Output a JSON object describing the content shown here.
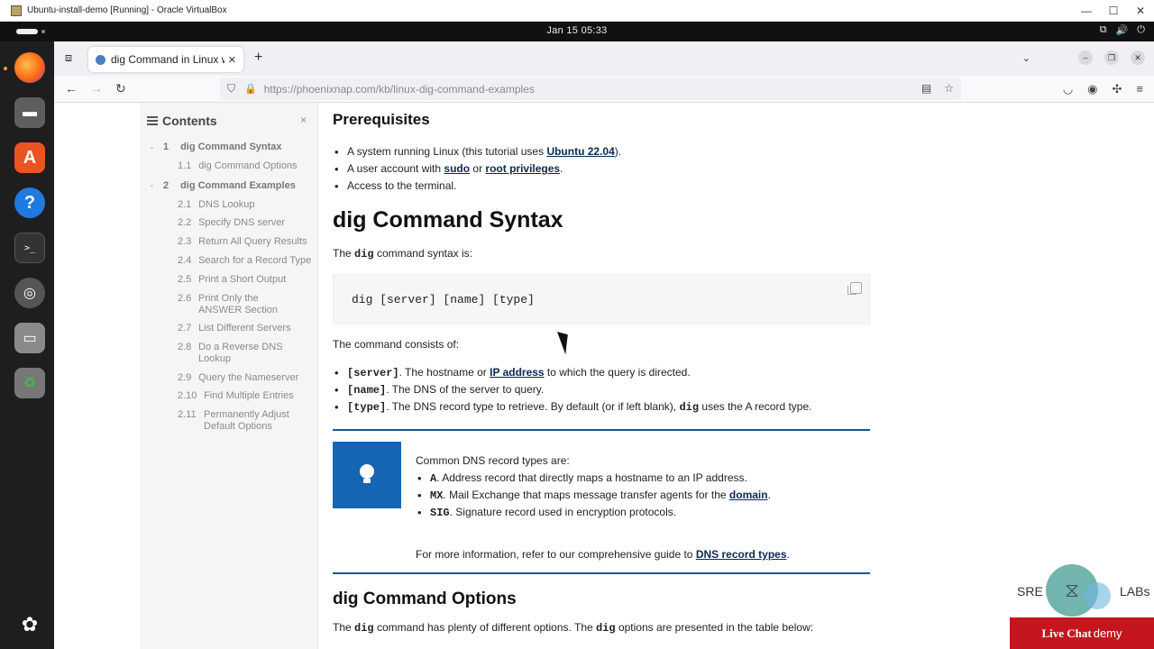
{
  "host_window": {
    "title": "Ubuntu-install-demo [Running] - Oracle VirtualBox",
    "min": "—",
    "max": "☐",
    "close": "✕"
  },
  "gnome": {
    "clock": "Jan 15  05:33"
  },
  "browser": {
    "tab_title": "dig Command in Linux wi",
    "tab_close": "✕",
    "new_tab": "+",
    "url_host": "https://phoenixnap.com",
    "url_path": "/kb/linux-dig-command-examples"
  },
  "toc": {
    "title": "Contents",
    "close": "×",
    "items": [
      {
        "num": "1",
        "label": "dig Command Syntax"
      },
      {
        "num": "1.1",
        "label": "dig Command Options"
      },
      {
        "num": "2",
        "label": "dig Command Examples"
      },
      {
        "num": "2.1",
        "label": "DNS Lookup"
      },
      {
        "num": "2.2",
        "label": "Specify DNS server"
      },
      {
        "num": "2.3",
        "label": "Return All Query Results"
      },
      {
        "num": "2.4",
        "label": "Search for a Record Type"
      },
      {
        "num": "2.5",
        "label": "Print a Short Output"
      },
      {
        "num": "2.6",
        "label": "Print Only the ANSWER Section"
      },
      {
        "num": "2.7",
        "label": "List Different Servers"
      },
      {
        "num": "2.8",
        "label": "Do a Reverse DNS Lookup"
      },
      {
        "num": "2.9",
        "label": "Query the Nameserver"
      },
      {
        "num": "2.10",
        "label": "Find Multiple Entries"
      },
      {
        "num": "2.11",
        "label": "Permanently Adjust Default Options"
      }
    ]
  },
  "article": {
    "prereq_title": "Prerequisites",
    "prereq": {
      "p1_pre": "A system running Linux (this tutorial uses ",
      "p1_link": "Ubuntu 22.04",
      "p1_post": ").",
      "p2_pre": "A user account with ",
      "p2_link1": "sudo",
      "p2_mid": " or ",
      "p2_link2": "root privileges",
      "p2_post": ".",
      "p3": "Access to the terminal."
    },
    "syntax_title": "dig Command Syntax",
    "syntax_intro_pre": "The ",
    "syntax_intro_code": "dig",
    "syntax_intro_post": " command syntax is:",
    "code": "dig [server] [name] [type]",
    "consists": "The command consists of:",
    "parts": {
      "s_code": "[server]",
      "s_pre": ". The hostname or ",
      "s_link": "IP address",
      "s_post": " to which the query is directed.",
      "n_code": "[name]",
      "n_text": ". The DNS of the server to query.",
      "t_code": "[type]",
      "t_pre": ". The DNS record type to retrieve. By default (or if left blank), ",
      "t_code2": "dig",
      "t_post": " uses the A record type."
    },
    "tip": {
      "intro": "Common DNS record types are:",
      "a_code": "A",
      "a_text": ". Address record that directly maps a hostname to an IP address.",
      "mx_code": "MX",
      "mx_pre": ". Mail Exchange that maps message transfer agents for the ",
      "mx_link": "domain",
      "mx_post": ".",
      "sig_code": "SIG",
      "sig_text": ". Signature record used in encryption protocols.",
      "more_pre": "For more information, refer to our comprehensive guide to ",
      "more_link": "DNS record types",
      "more_post": "."
    },
    "options_title": "dig Command Options",
    "options_pre": "The ",
    "options_code1": "dig",
    "options_mid": " command has plenty of different options. The ",
    "options_code2": "dig",
    "options_post": " options are presented in the table below:"
  },
  "watermark": {
    "left": "SRE",
    "right": "LABs"
  },
  "live_chat": {
    "label": "Live Chat",
    "suffix": "demy"
  },
  "colors": {
    "accent_blue": "#1565b4",
    "rule_blue": "#0d5a97",
    "live_chat_red": "#c4161c"
  }
}
